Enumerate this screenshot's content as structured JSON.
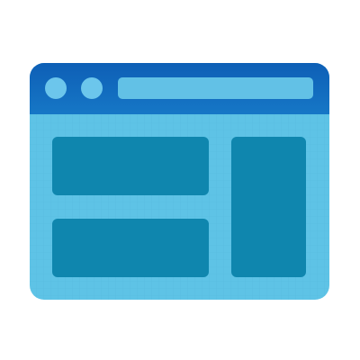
{
  "icon": {
    "name": "app-window-layout-icon",
    "colors": {
      "background": "#ffffff",
      "title_bar_top": "#0e5fb6",
      "title_bar_bottom": "#1677c6",
      "window_body": "#5ec3e6",
      "window_body_edge": "#59bde1",
      "window_controls": "#6cc6ec",
      "address_bar": "#62c1e6",
      "panels": "#0f86ae",
      "grid_line": "#4fb0d6"
    },
    "window_control_count": 2,
    "panel_count": 3
  }
}
